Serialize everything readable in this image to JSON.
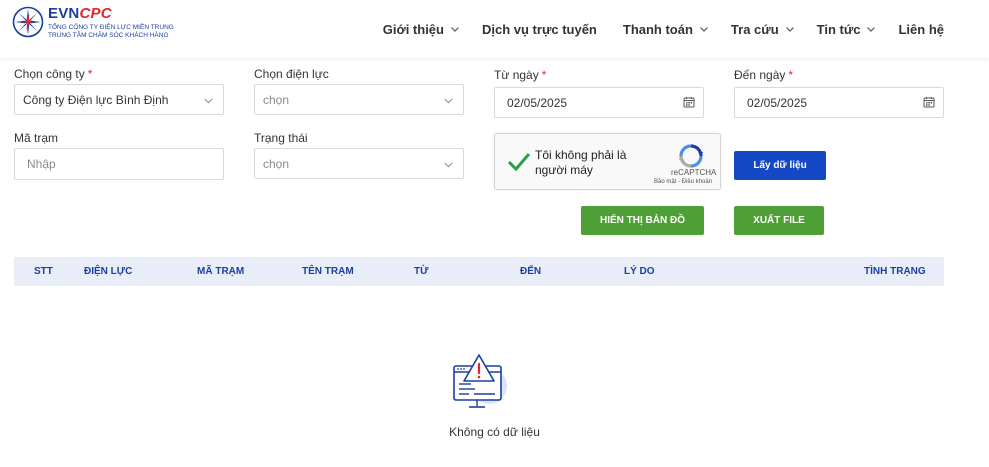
{
  "header": {
    "brand_evn": "EVN",
    "brand_cpc": "CPC",
    "sub1": "TỔNG CÔNG TY ĐIỆN LỰC MIỀN TRUNG",
    "sub2": "TRUNG TÂM CHĂM SÓC KHÁCH HÀNG",
    "nav": [
      {
        "label": "Giới thiệu",
        "has_dropdown": true
      },
      {
        "label": "Dịch vụ trực tuyến",
        "has_dropdown": false
      },
      {
        "label": "Thanh toán",
        "has_dropdown": true
      },
      {
        "label": "Tra cứu",
        "has_dropdown": true
      },
      {
        "label": "Tin tức",
        "has_dropdown": true
      },
      {
        "label": "Liên hệ",
        "has_dropdown": false
      }
    ]
  },
  "form": {
    "company": {
      "label": "Chọn công ty",
      "required": "*",
      "value": "Công ty Điện lực Bình Định"
    },
    "electricity": {
      "label": "Chọn điện lực",
      "placeholder": "chọn"
    },
    "from_date": {
      "label": "Từ ngày",
      "required": "*",
      "value": "02/05/2025"
    },
    "to_date": {
      "label": "Đến ngày",
      "required": "*",
      "value": "02/05/2025"
    },
    "station": {
      "label": "Mã trạm",
      "placeholder": "Nhập"
    },
    "status": {
      "label": "Trạng thái",
      "placeholder": "chọn"
    }
  },
  "captcha": {
    "text": "Tôi không phải là người máy",
    "brand": "reCAPTCHA",
    "links": "Bảo mật - Điều khoản"
  },
  "buttons": {
    "fetch": "Lấy dữ liệu",
    "map": "HIỂN THỊ BẢN ĐỒ",
    "export": "XUẤT FILE"
  },
  "table": {
    "columns": [
      "STT",
      "ĐIỆN LỰC",
      "MÃ TRẠM",
      "TÊN TRẠM",
      "TỪ",
      "ĐẾN",
      "LÝ DO",
      "TÌNH TRẠNG"
    ]
  },
  "empty": {
    "text": "Không có dữ liệu"
  },
  "colors": {
    "brand_blue": "#1b3fa0",
    "brand_red": "#e1262d",
    "button_blue": "#1548c4",
    "button_green": "#4e9f35",
    "table_header_bg": "#e8edf8"
  }
}
